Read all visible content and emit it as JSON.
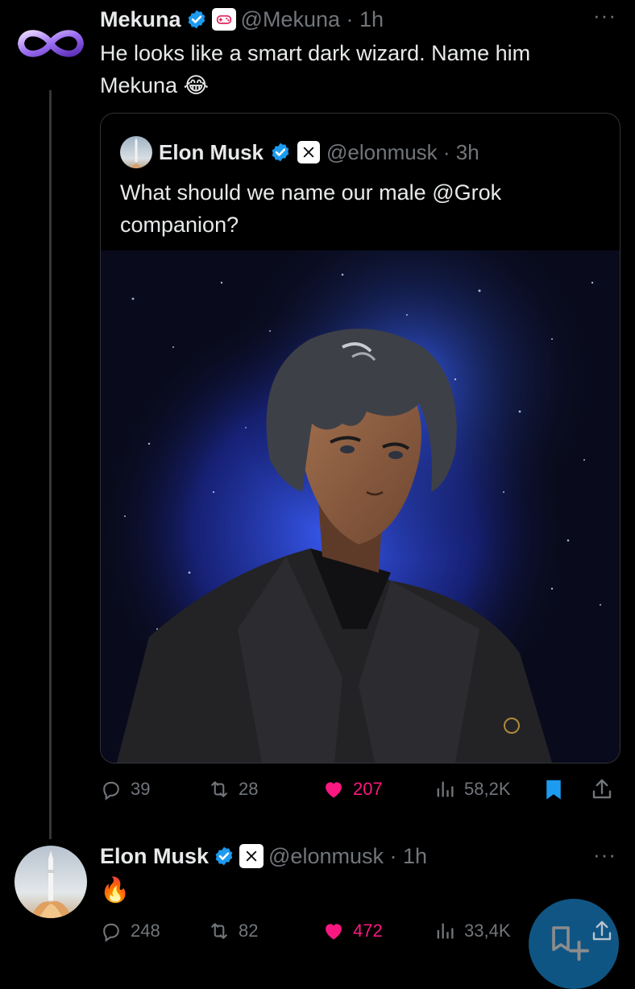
{
  "post1": {
    "author_name": "Mekuna",
    "handle_time": "@Mekuna · 1h",
    "text_line1": "He looks like a smart dark wizard. Name him",
    "text_line2": "Mekuna 😂",
    "more": "···",
    "quote": {
      "author_name": "Elon Musk",
      "handle_time": "@elonmusk · 3h",
      "text_line1": "What should we name our male @Grok",
      "text_line2": "companion?"
    },
    "actions": {
      "replies": "39",
      "reposts": "28",
      "likes": "207",
      "views": "58,2K"
    }
  },
  "post2": {
    "author_name": "Elon Musk",
    "handle_time": "@elonmusk · 1h",
    "text": "🔥",
    "more": "···",
    "actions": {
      "replies": "248",
      "reposts": "82",
      "likes": "472",
      "views": "33,4K"
    }
  },
  "colors": {
    "like": "#f91880",
    "verified": "#1d9bf0",
    "bookmark": "#1d9bf0",
    "fab": "#1d9bf0"
  }
}
